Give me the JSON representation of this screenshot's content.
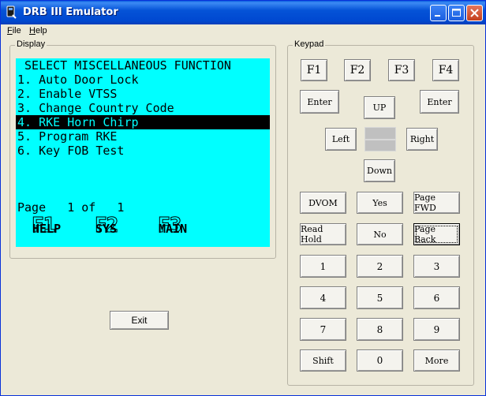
{
  "window": {
    "title": "DRB III Emulator"
  },
  "menu": {
    "items": [
      "File",
      "Help"
    ]
  },
  "display": {
    "group_label": "Display",
    "lines": [
      " SELECT MISCELLANEOUS FUNCTION",
      "1. Auto Door Lock",
      "2. Enable VTSS",
      "3. Change Country Code",
      "4. RKE Horn Chirp",
      "5. Program RKE",
      "6. Key FOB Test"
    ],
    "selected_line": "4. RKE Horn Chirp",
    "page_text": "Page   1 of   1",
    "fkeys": {
      "f1": "F1",
      "f2": "F2",
      "f3": "F3",
      "help": "HELP",
      "sys": "SYS",
      "main": "MAIN"
    },
    "screen_color": "#00ffff"
  },
  "exit_label": "Exit",
  "keypad": {
    "group_label": "Keypad",
    "f1": "F1",
    "f2": "F2",
    "f3": "F3",
    "f4": "F4",
    "enter_left": "Enter",
    "enter_right": "Enter",
    "up": "UP",
    "down": "Down",
    "left": "Left",
    "right": "Right",
    "dvom": "DVOM",
    "yes": "Yes",
    "page_fwd": "Page FWD",
    "read_hold": "Read Hold",
    "no": "No",
    "page_back": "Page Back",
    "n1": "1",
    "n2": "2",
    "n3": "3",
    "n4": "4",
    "n5": "5",
    "n6": "6",
    "n7": "7",
    "n8": "8",
    "n9": "9",
    "shift": "Shift",
    "n0": "0",
    "more": "More"
  }
}
